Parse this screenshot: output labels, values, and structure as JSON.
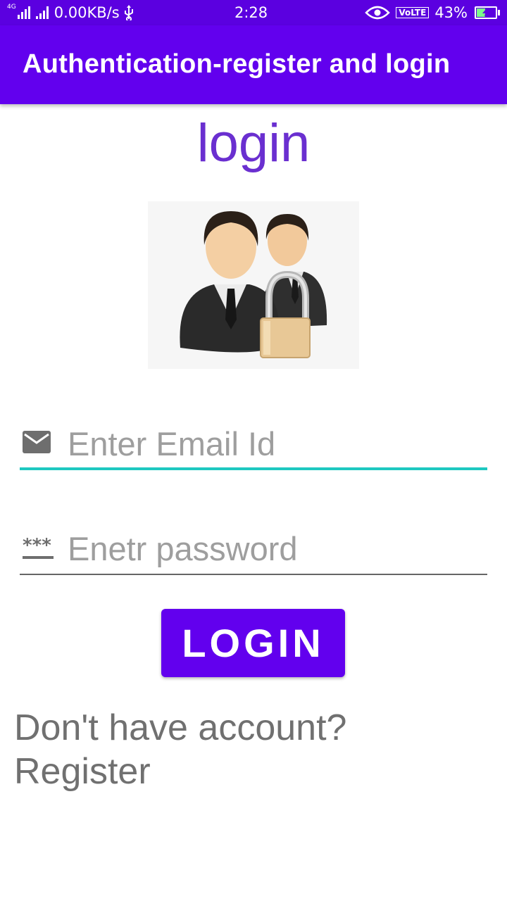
{
  "status_bar": {
    "network_label": "4G",
    "speed": "0.00KB/s",
    "time": "2:28",
    "volte": "VoLTE",
    "battery": "43%",
    "battery_level": 0.43,
    "icons": [
      "signal-icon",
      "usb-icon",
      "eye-icon",
      "battery-icon"
    ]
  },
  "app_bar": {
    "title": "Authentication-register and login"
  },
  "page": {
    "title": "login"
  },
  "hero_image": {
    "icon": "users-lock-icon"
  },
  "form": {
    "email": {
      "placeholder": "Enter Email Id",
      "value": "",
      "icon": "email-icon"
    },
    "password": {
      "placeholder": "Enetr password",
      "value": "",
      "icon": "password-icon"
    },
    "login_label": "LOGIN"
  },
  "footer": {
    "line1": "Don't have account?",
    "line2": "Register"
  },
  "colors": {
    "status_bar": "#5b00e0",
    "app_bar": "#6200ee",
    "page_title": "#6a2fd0",
    "button": "#6200ee",
    "focus_line": "#1ec8c0"
  }
}
